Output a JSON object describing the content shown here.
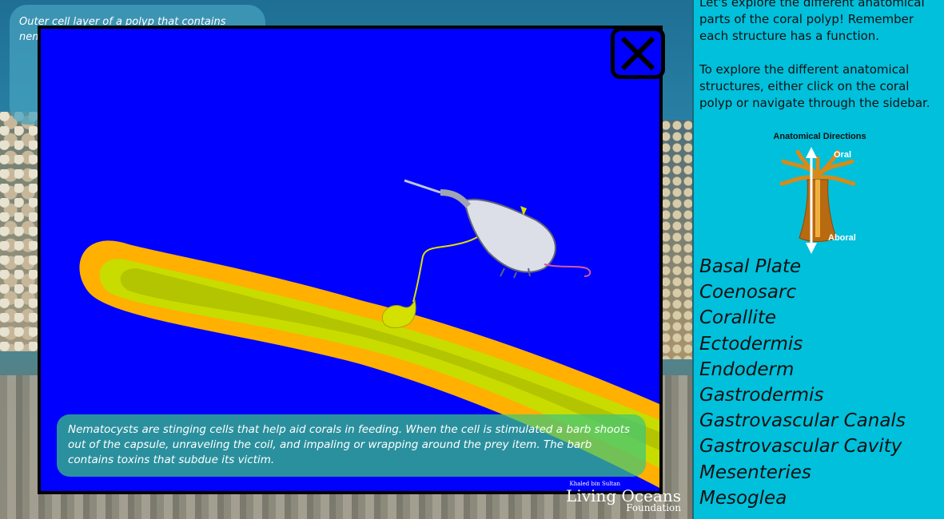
{
  "background": {
    "info_bubble_text": "Outer cell layer of a polyp that contains nematocysts, only"
  },
  "modal": {
    "caption": "Nematocysts are stinging cells that help aid corals in feeding. When the cell is stimulated a barb shoots out of the capsule, unraveling the coil, and impaling or wrapping around the prey item. The barb contains toxins that subdue its victim.",
    "close_icon": "close-x-icon",
    "colors": {
      "background": "#0000ff",
      "tentacle_outer": "#ffb000",
      "tentacle_inner": "#c8dc00",
      "nematocyst": "#d4e000"
    }
  },
  "logo": {
    "top": "Khaled bin Sultan",
    "main": "Living Oceans",
    "sub": "Foundation"
  },
  "sidebar": {
    "intro_1": "Let's explore the different anatomical parts of the coral polyp! Remember each structure has a function.",
    "intro_2": "To explore the different anatomical structures, either click on the coral polyp or navigate through the sidebar.",
    "directions_title": "Anatomical Directions",
    "oral_label": "Oral",
    "aboral_label": "Aboral",
    "structures": [
      "Basal Plate",
      "Coenosarc",
      "Corallite",
      "Ectodermis",
      "Endoderm",
      "Gastrodermis",
      "Gastrovascular Canals",
      "Gastrovascular Cavity",
      "Mesenteries",
      "Mesoglea"
    ],
    "accent_color": "#00c0dc"
  }
}
